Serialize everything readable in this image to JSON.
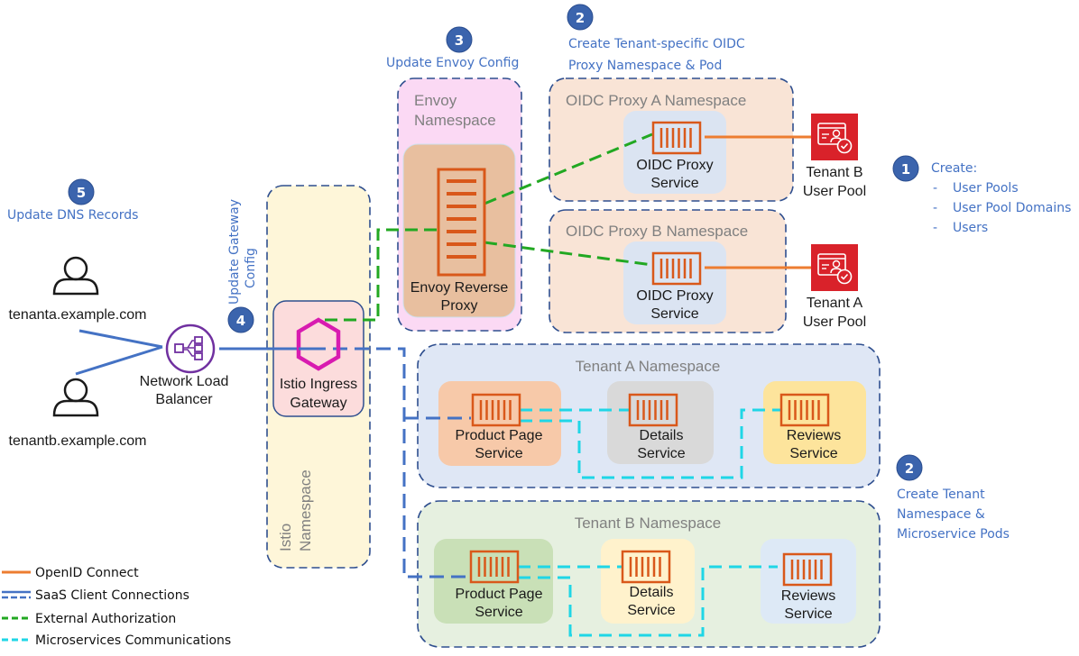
{
  "colors": {
    "step_blue": "#4472c4",
    "badge_fill": "#3b64ad",
    "openid": "#ed7d31",
    "saas": "#4472c4",
    "ext_auth": "#22a822",
    "micro": "#1fd6e6",
    "container_orange": "#d9581a",
    "istio_magenta": "#d81bb0",
    "nlb_purple": "#7030a0",
    "userpool_red": "#d9222a"
  },
  "steps": {
    "s5": {
      "num": "5",
      "label": "Update DNS Records"
    },
    "s4": {
      "num": "4",
      "label_line1": "Update Gateway",
      "label_line2": "Config"
    },
    "s3": {
      "num": "3",
      "label": "Update Envoy Config"
    },
    "s2_oidc": {
      "num": "2",
      "label_line1": "Create Tenant-specific OIDC",
      "label_line2": "Proxy Namespace & Pod"
    },
    "s1": {
      "num": "1",
      "title": "Create:",
      "items": [
        "User Pools",
        "User Pool Domains",
        "Users"
      ]
    },
    "s2_tenant": {
      "num": "2",
      "label_line1": "Create Tenant",
      "label_line2": "Namespace &",
      "label_line3": "Microservice Pods"
    }
  },
  "clients": {
    "tenanta": "tenanta.example.com",
    "tenantb": "tenantb.example.com"
  },
  "nlb": {
    "line1": "Network Load",
    "line2": "Balancer"
  },
  "istio": {
    "namespace_line1": "Istio",
    "namespace_line2": "Namespace",
    "gateway_line1": "Istio Ingress",
    "gateway_line2": "Gateway"
  },
  "envoy": {
    "namespace_line1": "Envoy",
    "namespace_line2": "Namespace",
    "proxy_line1": "Envoy Reverse",
    "proxy_line2": "Proxy"
  },
  "oidc": {
    "a": {
      "namespace": "OIDC Proxy A Namespace",
      "svc_line1": "OIDC Proxy",
      "svc_line2": "Service"
    },
    "b": {
      "namespace": "OIDC Proxy B Namespace",
      "svc_line1": "OIDC Proxy",
      "svc_line2": "Service"
    }
  },
  "user_pools": {
    "b": {
      "line1": "Tenant B",
      "line2": "User Pool"
    },
    "a": {
      "line1": "Tenant A",
      "line2": "User Pool"
    }
  },
  "tenant_a": {
    "namespace": "Tenant A Namespace",
    "services": [
      {
        "line1": "Product Page",
        "line2": "Service"
      },
      {
        "line1": "Details",
        "line2": "Service"
      },
      {
        "line1": "Reviews",
        "line2": "Service"
      }
    ]
  },
  "tenant_b": {
    "namespace": "Tenant B Namespace",
    "services": [
      {
        "line1": "Product Page",
        "line2": "Service"
      },
      {
        "line1": "Details",
        "line2": "Service"
      },
      {
        "line1": "Reviews",
        "line2": "Service"
      }
    ]
  },
  "legend": [
    {
      "label": "OpenID Connect",
      "style": "solid",
      "color": "#ed7d31"
    },
    {
      "label": "SaaS Client Connections",
      "style": "double-dashed",
      "color": "#4472c4"
    },
    {
      "label": "External Authorization",
      "style": "dashed",
      "color": "#22a822"
    },
    {
      "label": "Microservices Communications",
      "style": "dashed",
      "color": "#1fd6e6"
    }
  ]
}
